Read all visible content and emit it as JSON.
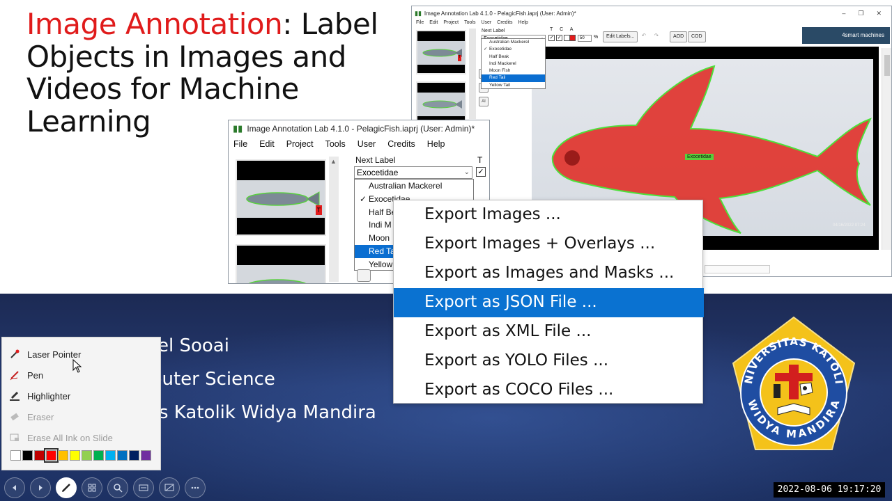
{
  "slide": {
    "title_accent": "Image Annotation",
    "title_rest": ": Label Objects in Images and Videos for Machine Learning",
    "author_lines": [
      "el Sooai",
      "puter Science",
      "s Katolik Widya Mandira"
    ]
  },
  "app_window": {
    "title": "Image Annotation Lab 4.1.0 - PelagicFish.iaprj (User: Admin)*",
    "menu": [
      "File",
      "Edit",
      "Project",
      "Tools",
      "User",
      "Credits",
      "Help"
    ],
    "next_label_caption": "Next Label",
    "next_label_value": "Exocetidae",
    "tca_header": "T C A",
    "opacity_value": "50",
    "opacity_unit": "%",
    "edit_labels_button": "Edit Labels...",
    "aod_button": "AOD",
    "cod_button": "COD",
    "ai_button": "AI",
    "brand_logo": "4smart machines",
    "label_options": [
      "Australian Mackerel",
      "Exocetidae",
      "Half Beak",
      "Indi Mackerel",
      "Moon Fish",
      "Red Tail",
      "Yellow Tail"
    ],
    "checked_option_index": 1,
    "highlighted_option_index": 5,
    "fish_label": "Exocetidae",
    "photo_date": "04/16/2022 07:24",
    "thumb_badge": "T"
  },
  "zoom_window": {
    "title": "Image Annotation Lab 4.1.0 - PelagicFish.iaprj (User: Admin)*",
    "menu": [
      "File",
      "Edit",
      "Project",
      "Tools",
      "User",
      "Credits",
      "Help"
    ],
    "next_label_caption": "Next Label",
    "next_label_value": "Exocetidae",
    "t_header": "T",
    "label_options": [
      "Australian Mackerel",
      "Exocetidae",
      "Half Be",
      "Indi M",
      "Moon",
      "Red Ta",
      "Yellow"
    ],
    "checked_option_index": 1,
    "highlighted_option_index": 5,
    "thumb_badge": "T"
  },
  "export_menu": {
    "items": [
      "Export Images ...",
      "Export Images + Overlays ...",
      "Export as Images and Masks ...",
      "Export as JSON File ...",
      "Export as XML File ...",
      "Export as YOLO Files ...",
      "Export as COCO Files ..."
    ],
    "highlighted_index": 3
  },
  "pen_menu": {
    "items": [
      {
        "label": "Laser Pointer",
        "icon": "laser-pointer-icon",
        "enabled": true
      },
      {
        "label": "Pen",
        "icon": "pen-icon",
        "enabled": true
      },
      {
        "label": "Highlighter",
        "icon": "highlighter-icon",
        "enabled": true
      },
      {
        "label": "Eraser",
        "icon": "eraser-icon",
        "enabled": false
      },
      {
        "label": "Erase All Ink on Slide",
        "icon": "erase-all-icon",
        "enabled": false
      }
    ],
    "colors": [
      "#ffffff",
      "#000000",
      "#c00000",
      "#ff0000",
      "#ffc000",
      "#ffff00",
      "#92d050",
      "#00b050",
      "#00b0f0",
      "#0070c0",
      "#002060",
      "#7030a0"
    ],
    "selected_color_index": 3
  },
  "toolbar": {
    "buttons": [
      "previous-icon",
      "next-icon",
      "pen-icon",
      "slides-icon",
      "zoom-icon",
      "subtitles-icon",
      "screen-icon",
      "more-icon"
    ],
    "active_index": 2
  },
  "logo": {
    "top_text": "UNIVERSITAS KATOLIK",
    "bottom_text": "WIDYA MANDIRA"
  },
  "timestamp": "2022-08-06 19:17:20",
  "colors": {
    "accent_red": "#e01b1b",
    "selection_blue": "#0a72d1",
    "slide_blue": "#24396f",
    "logo_yellow": "#f4c21a",
    "logo_blue": "#1f4da2"
  }
}
